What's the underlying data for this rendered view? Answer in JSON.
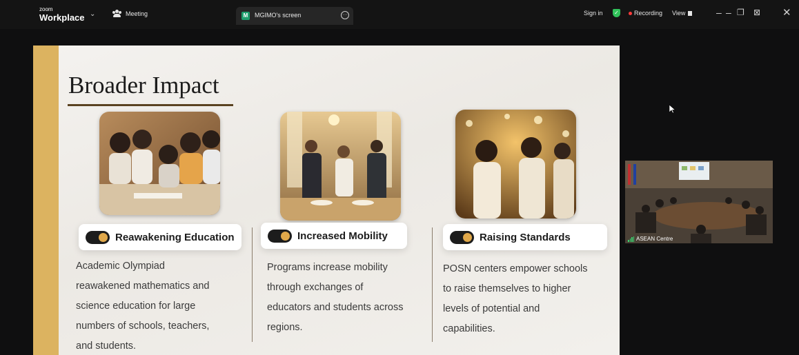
{
  "app": {
    "brand_small": "zoom",
    "brand_big": "Workplace",
    "meeting_label": "Meeting",
    "share_tab_badge": "M",
    "share_tab_label": "MGIMO's screen",
    "sign_in": "Sign in",
    "recording": "Recording",
    "view": "View",
    "colors": {
      "recording_dot": "#ff3b3b",
      "shield": "#31c25a",
      "share_badge": "#1f9e6e"
    }
  },
  "slide": {
    "title": "Broader Impact",
    "accent_color": "#dcb360",
    "cards": [
      {
        "label": "Reawakening Education",
        "description": [
          "Academic Olympiad",
          "reawakened mathematics and",
          "science education for large",
          "numbers of schools, teachers,",
          "and students."
        ]
      },
      {
        "label": "Increased Mobility",
        "description": [
          "Programs increase mobility",
          "through exchanges of",
          "educators and students across",
          "regions."
        ]
      },
      {
        "label": "Raising Standards",
        "description": [
          "POSN centers empower schools",
          "to raise themselves to higher",
          "levels of potential and",
          "capabilities."
        ]
      }
    ]
  },
  "participant": {
    "name": "ASEAN Centre"
  }
}
